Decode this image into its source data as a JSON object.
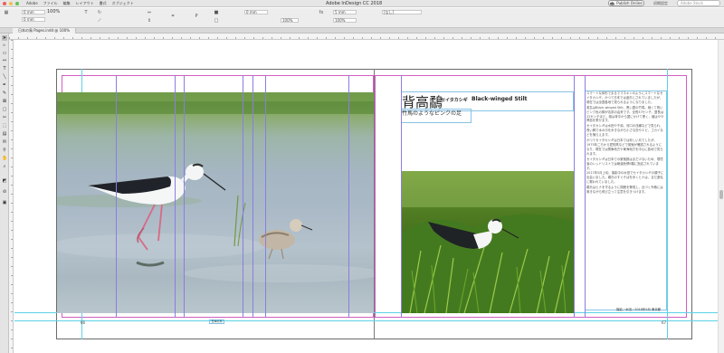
{
  "menubar": {
    "menus": [
      "Adobe",
      "ファイル",
      "編集",
      "レイアウト",
      "書式",
      "オブジェクト"
    ],
    "app_title": "Adobe InDesign CC 2018",
    "publish_label": "Publish Online",
    "workspace_label": "初期設定",
    "help_search_placeholder": "Adobe Stock"
  },
  "control_panel": {
    "zoom": "100%",
    "x_field": "0 mm",
    "y_field": "0 mm",
    "w_field": "5 mm",
    "h_field": "100%",
    "stroke_field": "0 mm",
    "percent_field": "100%",
    "style_field": "[なし]"
  },
  "document_tab": {
    "label": "日本の鳥 Pages.indd @ 100%"
  },
  "tools": [
    "selection",
    "direct-selection",
    "page",
    "gap",
    "type",
    "line",
    "pen",
    "pencil",
    "rectangle-frame",
    "rectangle",
    "scissors",
    "free-transform",
    "gradient",
    "note",
    "eyedropper",
    "hand",
    "zoom",
    "fill-stroke",
    "apply-none",
    "view-mode"
  ],
  "spread": {
    "title_kanji": "背高鷸",
    "title_kana": "セイタカシギ",
    "title_en": "Black-winged Stilt",
    "subtitle": "竹馬のようなピンクの足",
    "body_paragraphs": [
      "スマートな体形でまるでマネキンのようにスマートなセイタカシギ。かつて日本では迷鳥とされていましたが、現在では全国各地で見られるようになりました。",
      "英名はBlack-winged Stilt、黒い翼の竹馬。細くて長いピンク色の脚が名前の由来です。全長37センチ、翼長は22センチほど。雄は背中から翼にかけて黒く、雌はやや褐色を帯びます。",
      "セイタカシギは水田や干潟、河口の浅瀬などで見られ、長い脚で水の中を歩きながら小さな虫やエビ、ゴカイなどを捕らえます。",
      "かつてセイタカシギは日本では珍しい鳥でしたが、1975年ごろから愛知県などで繁殖が確認されるようになり、現在では関東地方や東海地方を中心に各地で見られます。",
      "セイタカシギは日本での繁殖数はまだ少ないため、環境省のレッドリストでは絶滅危惧II類に指定されています。",
      "2017年5月上旬、撮影中の水田でセイタカシギの親子に出会いました。親鳥のすぐそばを歩くヒナは、まだ産毛に覆われていました。",
      "親鳥はヒナを守るように周囲を警戒し、近づく外敵には鳴きながら飛び立って注意を引きつけます。"
    ],
    "caption": "撮影／水田／2018年5月 東京都",
    "folio_left": "66",
    "folio_right": "67",
    "folio_mid": "日本の鳥"
  },
  "colors": {
    "margin_guide": "#d25ec2",
    "column_guide": "#8a7ee0",
    "bleed_guide": "#5ad2e6",
    "frame_edge": "#86c3e5"
  }
}
